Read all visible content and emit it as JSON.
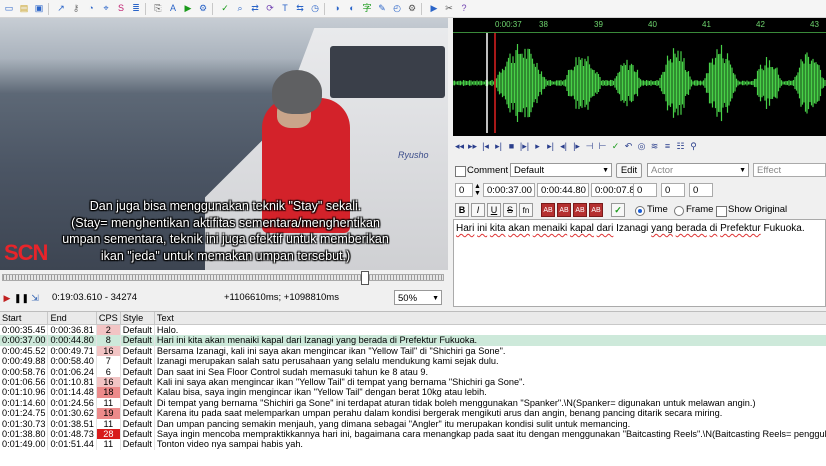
{
  "toolbar": {
    "icons": [
      "new-file-icon",
      "open-folder-icon",
      "save-icon",
      "jump-icon",
      "keyframe-icon",
      "timing-icon",
      "pin-icon",
      "styles-icon",
      "properties-icon",
      "attachments-icon",
      "fonts-icon",
      "video-icon",
      "automation-icon",
      "spell-icon",
      "find-icon",
      "replace-icon",
      "resample-icon",
      "translate-icon",
      "shift-icon",
      "timing-post-icon",
      "translation-icon",
      "translate-assist-icon",
      "kanji-icon",
      "visual-typeset-icon",
      "clock-icon",
      "gear-icon",
      "play-icon",
      "tools-icon",
      "help-icon"
    ]
  },
  "video": {
    "subtitle_lines": [
      "Dan juga bisa menggunakan teknik \"Stay\" sekali.",
      "(Stay= menghentikan aktifitas sementara/menghentikan",
      "umpan sementara, teknik ini juga efektif untuk memberikan",
      "ikan \"jeda\" untuk memakan umpan tersebut.)"
    ],
    "logo": "SCN",
    "boat_text": "Ryusho",
    "seek_position": 0.82,
    "time": "0:19:03.610 - 34274",
    "position": "+1106610ms; +1098810ms",
    "zoom": "50%"
  },
  "audio": {
    "ruler": [
      "0:00:37",
      "38",
      "39",
      "40",
      "41",
      "42",
      "43"
    ],
    "waveform_color": "#48d048"
  },
  "editor": {
    "comment_label": "Comment",
    "style": "Default",
    "edit_label": "Edit",
    "actor_placeholder": "Actor",
    "effect_placeholder": "Effect",
    "layer": "0",
    "start": "0:00:37.00",
    "end": "0:00:44.80",
    "duration": "0:00:07.80",
    "margin_l": "0",
    "margin_r": "0",
    "margin_v": "0",
    "bold": "B",
    "italic": "I",
    "underline": "U",
    "strike": "S",
    "font": "fn",
    "colors": [
      "AB",
      "AB",
      "AB",
      "AB"
    ],
    "time_label": "Time",
    "frame_label": "Frame",
    "show_original_label": "Show Original",
    "text_words": [
      "Hari",
      "ini",
      "kita",
      "akan",
      "menaiki",
      "kapal",
      "dari",
      "Izanagi",
      "yang",
      "berada",
      "di",
      "Prefektur",
      "Fukuoka."
    ]
  },
  "grid": {
    "headers": [
      "Start",
      "End",
      "CPS",
      "Style",
      "Text"
    ],
    "rows": [
      {
        "start": "0:00:35.45",
        "end": "0:00:36.81",
        "cps": "2",
        "style": "Default",
        "text": "Halo.",
        "level": "warn"
      },
      {
        "start": "0:00:37.00",
        "end": "0:00:44.80",
        "cps": "8",
        "style": "Default",
        "text": "Hari ini kita akan menaiki kapal dari Izanagi yang berada di Prefektur Fukuoka.",
        "level": "active"
      },
      {
        "start": "0:00:45.52",
        "end": "0:00:49.71",
        "cps": "16",
        "style": "Default",
        "text": "Bersama Izanagi, kali ini saya akan mengincar ikan \"Yellow Tail\" di \"Shichiri ga Sone\".",
        "level": "warn"
      },
      {
        "start": "0:00:49.88",
        "end": "0:00:58.40",
        "cps": "7",
        "style": "Default",
        "text": "Izanagi merupakan salah satu perusahaan yang selalu mendukung kami sejak dulu.",
        "level": ""
      },
      {
        "start": "0:00:58.76",
        "end": "0:01:06.24",
        "cps": "6",
        "style": "Default",
        "text": "Dan saat ini Sea Floor Control sudah memasuki tahun ke 8 atau 9.",
        "level": ""
      },
      {
        "start": "0:01:06.56",
        "end": "0:01:10.81",
        "cps": "16",
        "style": "Default",
        "text": "Kali ini saya akan mengincar ikan \"Yellow Tail\" di tempat yang bernama \"Shichiri ga Sone\".",
        "level": "warn"
      },
      {
        "start": "0:01:10.96",
        "end": "0:01:14.48",
        "cps": "18",
        "style": "Default",
        "text": "Kalau bisa, saya ingin mengincar ikan \"Yellow Tail\" dengan berat 10kg atau lebih.",
        "level": "bad"
      },
      {
        "start": "0:01:14.60",
        "end": "0:01:24.56",
        "cps": "11",
        "style": "Default",
        "text": "Di tempat yang bernama \"Shichiri ga Sone\" ini terdapat aturan tidak boleh menggunakan \"Spanker\".\\N(Spanker= digunakan untuk melawan angin.)",
        "level": ""
      },
      {
        "start": "0:01:24.75",
        "end": "0:01:30.62",
        "cps": "19",
        "style": "Default",
        "text": "Karena itu pada saat melemparkan umpan perahu dalam kondisi bergerak mengikuti arus dan angin, benang pancing ditarik secara miring.",
        "level": "bad"
      },
      {
        "start": "0:01:30.73",
        "end": "0:01:38.51",
        "cps": "11",
        "style": "Default",
        "text": "Dan umpan pancing semakin menjauh, yang dimana sebagai \"Angler\" itu merupakan kondisi sulit untuk memancing.",
        "level": ""
      },
      {
        "start": "0:01:38.80",
        "end": "0:01:48.73",
        "cps": "28",
        "style": "Default",
        "text": "Saya ingin mencoba mempraktikkannya hari ini, bagaimana cara menangkap pada saat itu dengan menggunakan \"Baitcasting Reels\".\\N(Baitcasting Reels= penggulung senar pancing yang dirancang untuk",
        "level": "hot"
      },
      {
        "start": "0:01:49.00",
        "end": "0:01:51.44",
        "cps": "11",
        "style": "Default",
        "text": "Tonton video nya sampai habis yah.",
        "level": ""
      }
    ]
  }
}
